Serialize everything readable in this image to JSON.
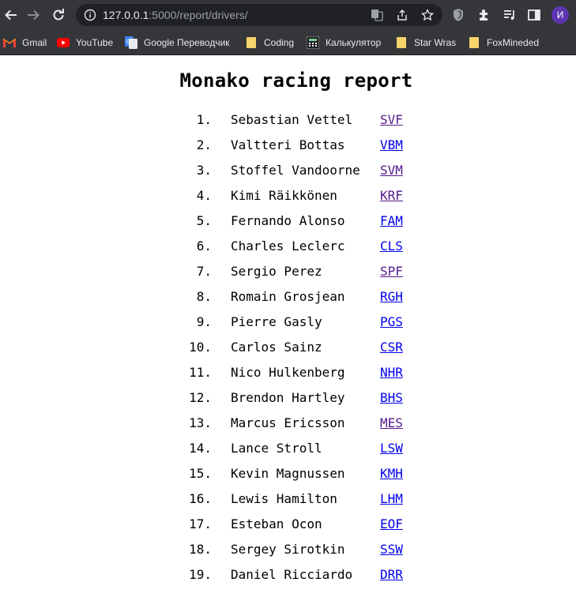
{
  "browser": {
    "url_host": "127.0.0.1",
    "url_rest": ":5000/report/drivers/",
    "avatar_letter": "И",
    "bookmarks": [
      {
        "label": "Gmail",
        "icon": "gmail-icon"
      },
      {
        "label": "YouTube",
        "icon": "youtube-icon"
      },
      {
        "label": "Google Переводчик",
        "icon": "google-translate-icon"
      },
      {
        "label": "Coding",
        "icon": "folder-icon"
      },
      {
        "label": "Калькулятор",
        "icon": "calculator-icon"
      },
      {
        "label": "Star Wras",
        "icon": "folder-icon"
      },
      {
        "label": "FoxMineded",
        "icon": "folder-icon"
      }
    ]
  },
  "page": {
    "title": "Monako racing report",
    "drivers": [
      {
        "num": "1.",
        "name": "Sebastian Vettel",
        "code": "SVF",
        "visited": true
      },
      {
        "num": "2.",
        "name": "Valtteri Bottas",
        "code": "VBM",
        "visited": false
      },
      {
        "num": "3.",
        "name": "Stoffel Vandoorne",
        "code": "SVM",
        "visited": true
      },
      {
        "num": "4.",
        "name": "Kimi Räikkönen",
        "code": "KRF",
        "visited": true
      },
      {
        "num": "5.",
        "name": "Fernando Alonso",
        "code": "FAM",
        "visited": false
      },
      {
        "num": "6.",
        "name": "Charles Leclerc",
        "code": "CLS",
        "visited": false
      },
      {
        "num": "7.",
        "name": "Sergio Perez",
        "code": "SPF",
        "visited": true
      },
      {
        "num": "8.",
        "name": "Romain Grosjean",
        "code": "RGH",
        "visited": false
      },
      {
        "num": "9.",
        "name": "Pierre Gasly",
        "code": "PGS",
        "visited": false
      },
      {
        "num": "10.",
        "name": "Carlos Sainz",
        "code": "CSR",
        "visited": false
      },
      {
        "num": "11.",
        "name": "Nico Hulkenberg",
        "code": "NHR",
        "visited": false
      },
      {
        "num": "12.",
        "name": "Brendon Hartley",
        "code": "BHS",
        "visited": false
      },
      {
        "num": "13.",
        "name": "Marcus Ericsson",
        "code": "MES",
        "visited": true
      },
      {
        "num": "14.",
        "name": "Lance Stroll",
        "code": "LSW",
        "visited": false
      },
      {
        "num": "15.",
        "name": "Kevin Magnussen",
        "code": "KMH",
        "visited": false
      },
      {
        "num": "16.",
        "name": "Lewis Hamilton",
        "code": "LHM",
        "visited": false
      },
      {
        "num": "17.",
        "name": "Esteban Ocon",
        "code": "EOF",
        "visited": false
      },
      {
        "num": "18.",
        "name": "Sergey Sirotkin",
        "code": "SSW",
        "visited": false
      },
      {
        "num": "19.",
        "name": "Daniel Ricciardo",
        "code": "DRR",
        "visited": false
      }
    ]
  },
  "colors": {
    "link_unvisited": "#0000ee",
    "link_visited": "#551a8b",
    "chrome_bg": "#35363a",
    "omnibox_bg": "#202124"
  }
}
